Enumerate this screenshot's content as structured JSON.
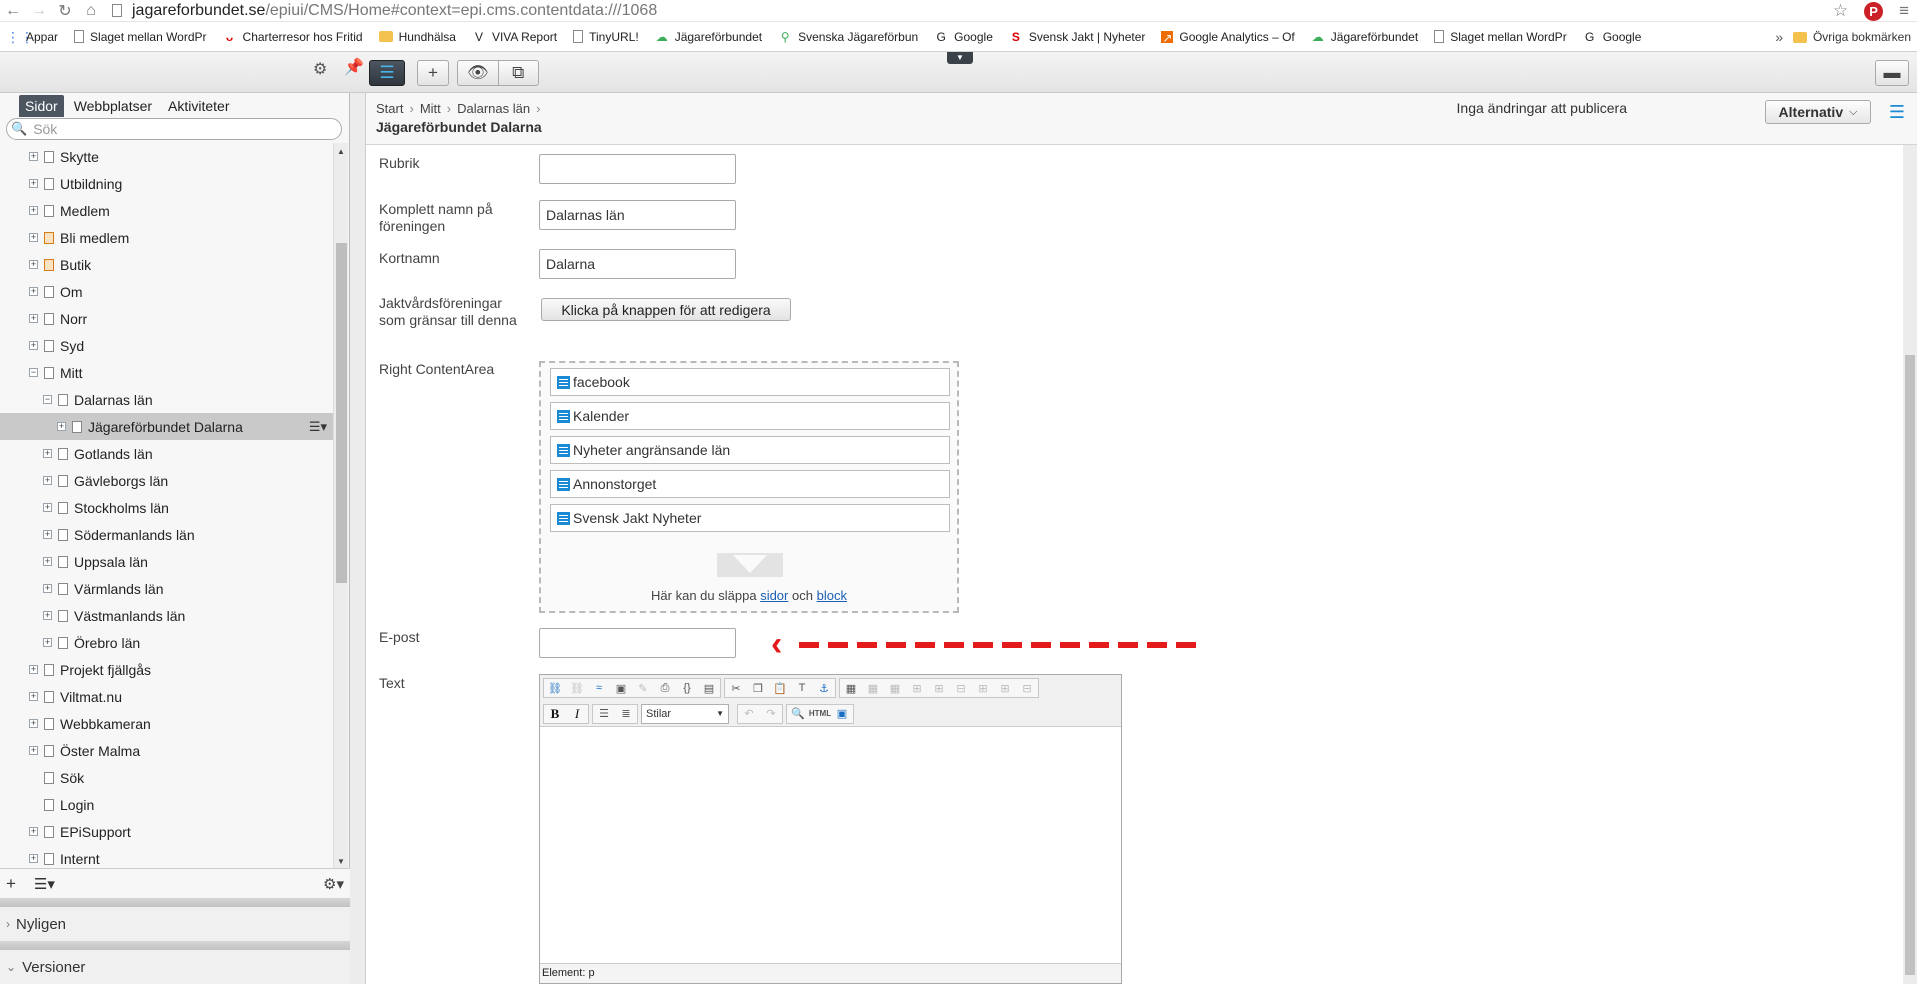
{
  "browser": {
    "url_host": "jagareforbundet.se",
    "url_path": "/epiui/CMS/Home#context=epi.cms.contentdata:///1068",
    "bookmarks": [
      {
        "label": "Appar",
        "icon": "apps-grid-icon"
      },
      {
        "label": "Slaget mellan WordPr",
        "icon": "page-icon"
      },
      {
        "label": "Charterresor hos Fritid",
        "icon": "tui-icon"
      },
      {
        "label": "Hundhälsa",
        "icon": "folder-icon"
      },
      {
        "label": "VIVA Report",
        "icon": "viva-icon"
      },
      {
        "label": "TinyURL!",
        "icon": "page-icon"
      },
      {
        "label": "Jägareförbundet",
        "icon": "jf-leaf-icon"
      },
      {
        "label": "Svenska Jägareförbun",
        "icon": "hunter-icon"
      },
      {
        "label": "Google",
        "icon": "google-icon"
      },
      {
        "label": "Svensk Jakt | Nyheter",
        "icon": "svensk-jakt-icon"
      },
      {
        "label": "Google Analytics – Of",
        "icon": "analytics-icon"
      },
      {
        "label": "Jägareförbundet",
        "icon": "jf-leaf-icon"
      },
      {
        "label": "Slaget mellan WordPr",
        "icon": "page-icon"
      },
      {
        "label": "Google",
        "icon": "google-icon"
      }
    ],
    "more_bookmarks": "»",
    "other_bookmarks": "Övriga bokmärken"
  },
  "left_pane": {
    "tabs": [
      {
        "label": "Sidor",
        "active": true
      },
      {
        "label": "Webbplatser",
        "active": false
      },
      {
        "label": "Aktiviteter",
        "active": false
      }
    ],
    "search_placeholder": "Sök",
    "tree": [
      {
        "label": "Skytte",
        "depth": 0,
        "toggle": "+",
        "cart": false
      },
      {
        "label": "Utbildning",
        "depth": 0,
        "toggle": "+",
        "cart": false
      },
      {
        "label": "Medlem",
        "depth": 0,
        "toggle": "+",
        "cart": false
      },
      {
        "label": "Bli medlem",
        "depth": 0,
        "toggle": "+",
        "cart": true
      },
      {
        "label": "Butik",
        "depth": 0,
        "toggle": "+",
        "cart": true
      },
      {
        "label": "Om",
        "depth": 0,
        "toggle": "+",
        "cart": false
      },
      {
        "label": "Norr",
        "depth": 0,
        "toggle": "+",
        "cart": false
      },
      {
        "label": "Syd",
        "depth": 0,
        "toggle": "+",
        "cart": false
      },
      {
        "label": "Mitt",
        "depth": 0,
        "toggle": "−",
        "cart": false
      },
      {
        "label": "Dalarnas län",
        "depth": 1,
        "toggle": "−",
        "cart": false
      },
      {
        "label": "Jägareförbundet Dalarna",
        "depth": 2,
        "toggle": "+",
        "cart": false,
        "selected": true
      },
      {
        "label": "Gotlands län",
        "depth": 1,
        "toggle": "+",
        "cart": false
      },
      {
        "label": "Gävleborgs län",
        "depth": 1,
        "toggle": "+",
        "cart": false
      },
      {
        "label": "Stockholms län",
        "depth": 1,
        "toggle": "+",
        "cart": false
      },
      {
        "label": "Södermanlands län",
        "depth": 1,
        "toggle": "+",
        "cart": false
      },
      {
        "label": "Uppsala län",
        "depth": 1,
        "toggle": "+",
        "cart": false
      },
      {
        "label": "Värmlands län",
        "depth": 1,
        "toggle": "+",
        "cart": false
      },
      {
        "label": "Västmanlands län",
        "depth": 1,
        "toggle": "+",
        "cart": false
      },
      {
        "label": "Örebro län",
        "depth": 1,
        "toggle": "+",
        "cart": false
      },
      {
        "label": "Projekt fjällgås",
        "depth": 0,
        "toggle": "+",
        "cart": false
      },
      {
        "label": "Viltmat.nu",
        "depth": 0,
        "toggle": "+",
        "cart": false
      },
      {
        "label": "Webbkameran",
        "depth": 0,
        "toggle": "+",
        "cart": false
      },
      {
        "label": "Öster Malma",
        "depth": 0,
        "toggle": "+",
        "cart": false
      },
      {
        "label": "Sök",
        "depth": 0,
        "toggle": "",
        "cart": false
      },
      {
        "label": "Login",
        "depth": 0,
        "toggle": "",
        "cart": false
      },
      {
        "label": "EPiSupport",
        "depth": 0,
        "toggle": "+",
        "cart": false
      },
      {
        "label": "Internt",
        "depth": 0,
        "toggle": "+",
        "cart": false
      }
    ],
    "gadgets": [
      {
        "label": "Nyligen"
      },
      {
        "label": "Versioner"
      }
    ]
  },
  "content": {
    "breadcrumb": [
      "Start",
      "Mitt",
      "Dalarnas län"
    ],
    "page_title": "Jägareförbundet Dalarna",
    "publish_status": "Inga ändringar att publicera",
    "options_label": "Alternativ",
    "fields": {
      "rubrik": {
        "label": "Rubrik",
        "value": ""
      },
      "full_name": {
        "label": "Komplett namn på föreningen",
        "value": "Dalarnas län"
      },
      "short_name": {
        "label": "Kortnamn",
        "value": "Dalarna"
      },
      "neighbours": {
        "label": "Jaktvårdsföreningar som gränsar till denna",
        "button": "Klicka på knappen för att redigera"
      },
      "right_content_area": {
        "label": "Right ContentArea",
        "items": [
          "facebook",
          "Kalender",
          "Nyheter angränsande län",
          "Annonstorget",
          "Svensk Jakt Nyheter"
        ]
      },
      "email": {
        "label": "E-post",
        "value": ""
      },
      "text": {
        "label": "Text"
      }
    },
    "drop_hint": {
      "prefix": "Här kan du släppa",
      "link1": "sidor",
      "middle": "och",
      "link2": "block"
    },
    "editor": {
      "style_select": "Stilar",
      "html_label": "HTML",
      "status": "Element: p"
    }
  },
  "colors": {
    "accent": "#1a8ad4",
    "annotation": "#e31b1b",
    "toolbar_dark": "#3b4148"
  }
}
